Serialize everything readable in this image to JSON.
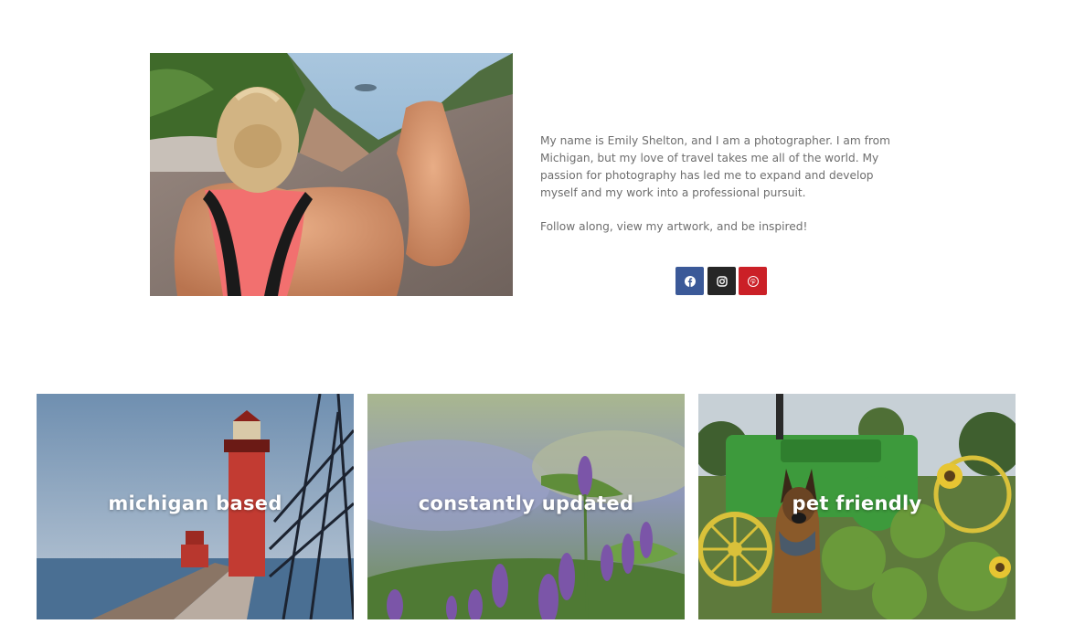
{
  "about": {
    "bio_paragraph": "My name is Emily Shelton, and I am a photographer.   I am from Michigan, but my love of travel takes me all of the world.   My passion for photography has led me to expand and develop myself and my work into a professional pursuit.",
    "follow_paragraph": "Follow along, view my artwork, and be inspired!"
  },
  "social": [
    {
      "icon": "facebook-icon",
      "color": "#3b5998"
    },
    {
      "icon": "instagram-icon",
      "color": "#262626"
    },
    {
      "icon": "pinterest-icon",
      "color": "#cb2027"
    }
  ],
  "cards": [
    {
      "title": "michigan based"
    },
    {
      "title": "constantly updated"
    },
    {
      "title": "pet friendly"
    }
  ]
}
